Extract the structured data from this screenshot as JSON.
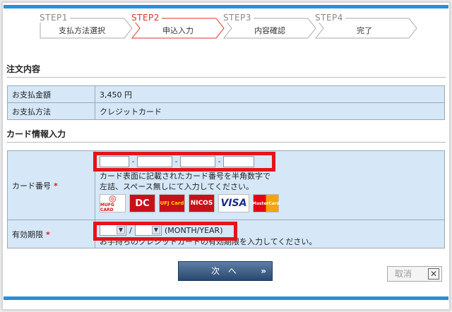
{
  "steps": [
    {
      "num": "STEP1",
      "label": "支払方法選択"
    },
    {
      "num": "STEP2",
      "label": "申込入力"
    },
    {
      "num": "STEP3",
      "label": "内容確認"
    },
    {
      "num": "STEP4",
      "label": "完了"
    }
  ],
  "order": {
    "title": "注文内容",
    "amount_label": "お支払金額",
    "amount_value": "3,450 円",
    "method_label": "お支払方法",
    "method_value": "クレジットカード"
  },
  "card": {
    "title": "カード情報入力",
    "number_label": "カード番号",
    "required_mark": "*",
    "separator": "-",
    "hint_line1": "カード表面に記載されたカード番号を半角数字で",
    "hint_line2": "左詰、スペース無しにて入力してください。",
    "brands": [
      "MUFG CARD",
      "DC",
      "UFJ Card",
      "NICOS",
      "VISA",
      "MasterCard"
    ],
    "expiry_label": "有効期限",
    "expiry_sep": "/",
    "expiry_format": "(MONTH/YEAR)",
    "expiry_hint": "お手持ちのクレジットカードの有効期限を入力してください。"
  },
  "buttons": {
    "next": "次 へ",
    "next_chevron": "»",
    "cancel": "取消",
    "cancel_x": "✕"
  },
  "colors": {
    "accent_bar": "#2a8fd6",
    "active_step": "#d8342c",
    "highlight": "#e3141b",
    "table_bg": "#d6e7f7"
  }
}
